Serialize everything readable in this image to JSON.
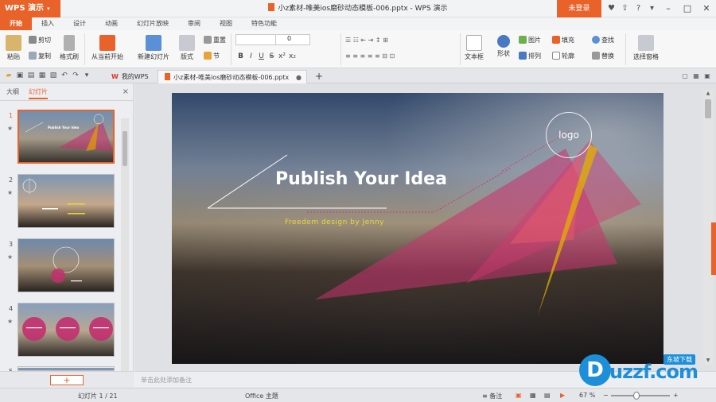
{
  "app": {
    "menu_label": "WPS 演示",
    "menu_arrow": "▾"
  },
  "window": {
    "title": "小z素材-唯美ios磨砂动态模板-006.pptx - WPS 演示",
    "login_label": "未登录"
  },
  "ribbon_tabs": [
    "开始",
    "插入",
    "设计",
    "动画",
    "幻灯片放映",
    "审阅",
    "视图",
    "特色功能"
  ],
  "ribbon": {
    "paste": "粘贴",
    "cut": "剪切",
    "copy": "复制",
    "format_painter": "格式刷",
    "from_current": "从当前开始",
    "new_slide": "新建幻灯片",
    "layout": "版式",
    "reset": "重置",
    "section": "节",
    "font_size": "0",
    "textbox": "文本框",
    "shape": "形状",
    "picture": "图片",
    "fill": "填充",
    "find": "查找",
    "arrange": "排列",
    "outline": "轮廓",
    "replace": "替换",
    "select_pane": "选择窗格"
  },
  "doc_tabs": {
    "home": "我的WPS",
    "current": "小z素材-唯美ios磨砂动态模板-006.pptx",
    "close_glyph": "●",
    "add": "+"
  },
  "left_pane": {
    "tab_outline": "大纲",
    "tab_slides": "幻灯片",
    "close": "×",
    "add_slide": "+",
    "thumbnails": [
      {
        "num": "1",
        "title": "Publish Your Idea"
      },
      {
        "num": "2",
        "title": ""
      },
      {
        "num": "3",
        "title": ""
      },
      {
        "num": "4",
        "title": ""
      },
      {
        "num": "5",
        "title": ""
      }
    ]
  },
  "slide": {
    "title": "Publish Your Idea",
    "subtitle": "Freedom design by Jenny",
    "logo": "logo"
  },
  "notes_placeholder": "单击此处添加备注",
  "status": {
    "slide_count": "幻灯片 1 / 21",
    "theme": "Office 主题",
    "notes": "备注",
    "zoom": "67 %"
  },
  "watermark": {
    "text": "uzzf.com",
    "badge": "东坡下载",
    "logo_char": "D"
  },
  "colors": {
    "accent": "#e8622a",
    "watermark": "#1d8fd8"
  }
}
